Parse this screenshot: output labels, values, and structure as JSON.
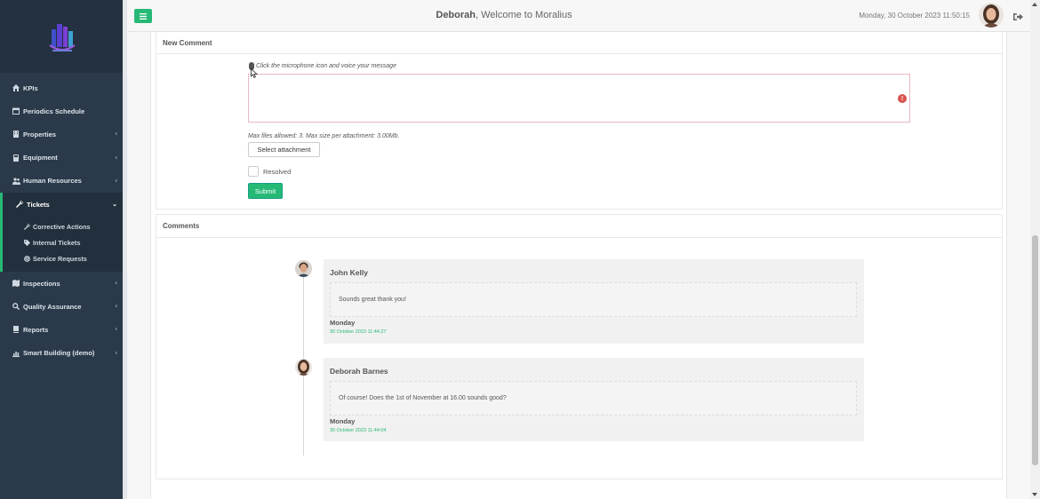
{
  "header": {
    "user_name": "Deborah",
    "welcome_suffix": ", Welcome to Moralius",
    "datetime": "Monday, 30 October 2023 11:50:15"
  },
  "sidebar": {
    "items": [
      {
        "label": "KPIs",
        "icon": "home-icon"
      },
      {
        "label": "Periodics Schedule",
        "icon": "calendar-icon"
      },
      {
        "label": "Properties",
        "icon": "building-icon"
      },
      {
        "label": "Equipment",
        "icon": "equipment-icon"
      },
      {
        "label": "Human Resources",
        "icon": "users-icon"
      },
      {
        "label": "Tickets",
        "icon": "wrench-icon"
      },
      {
        "label": "Inspections",
        "icon": "map-icon"
      },
      {
        "label": "Quality Assurance",
        "icon": "search-icon"
      },
      {
        "label": "Reports",
        "icon": "book-icon"
      },
      {
        "label": "Smart Building (demo)",
        "icon": "chart-icon"
      }
    ],
    "tickets_sub": [
      {
        "label": "Corrective Actions",
        "icon": "wrench-icon"
      },
      {
        "label": "Internal Tickets",
        "icon": "tag-icon"
      },
      {
        "label": "Service Requests",
        "icon": "lifebuoy-icon"
      }
    ]
  },
  "new_comment": {
    "title": "New Comment",
    "mic_hint": "Click the microphone icon and voice your message",
    "message_value": "",
    "max_files": "Max files allowed: 3. Max size per attachment: 3.00Mb.",
    "select_attachment": "Select attachment",
    "resolved_label": "Resolved",
    "submit_label": "Submit"
  },
  "comments": {
    "title": "Comments",
    "items": [
      {
        "author": "John Kelly",
        "message": "Sounds great thank you!",
        "day": "Monday",
        "date": "30 October 2023 11:44:27"
      },
      {
        "author": "Deborah Barnes",
        "message": "Of course! Does the 1st of November at 16.00 sounds good?",
        "day": "Monday",
        "date": "30 October 2023 11:44:04"
      }
    ]
  },
  "colors": {
    "accent": "#26b976",
    "sidebar_bg": "#2b3a4a",
    "error": "#d9534f"
  }
}
